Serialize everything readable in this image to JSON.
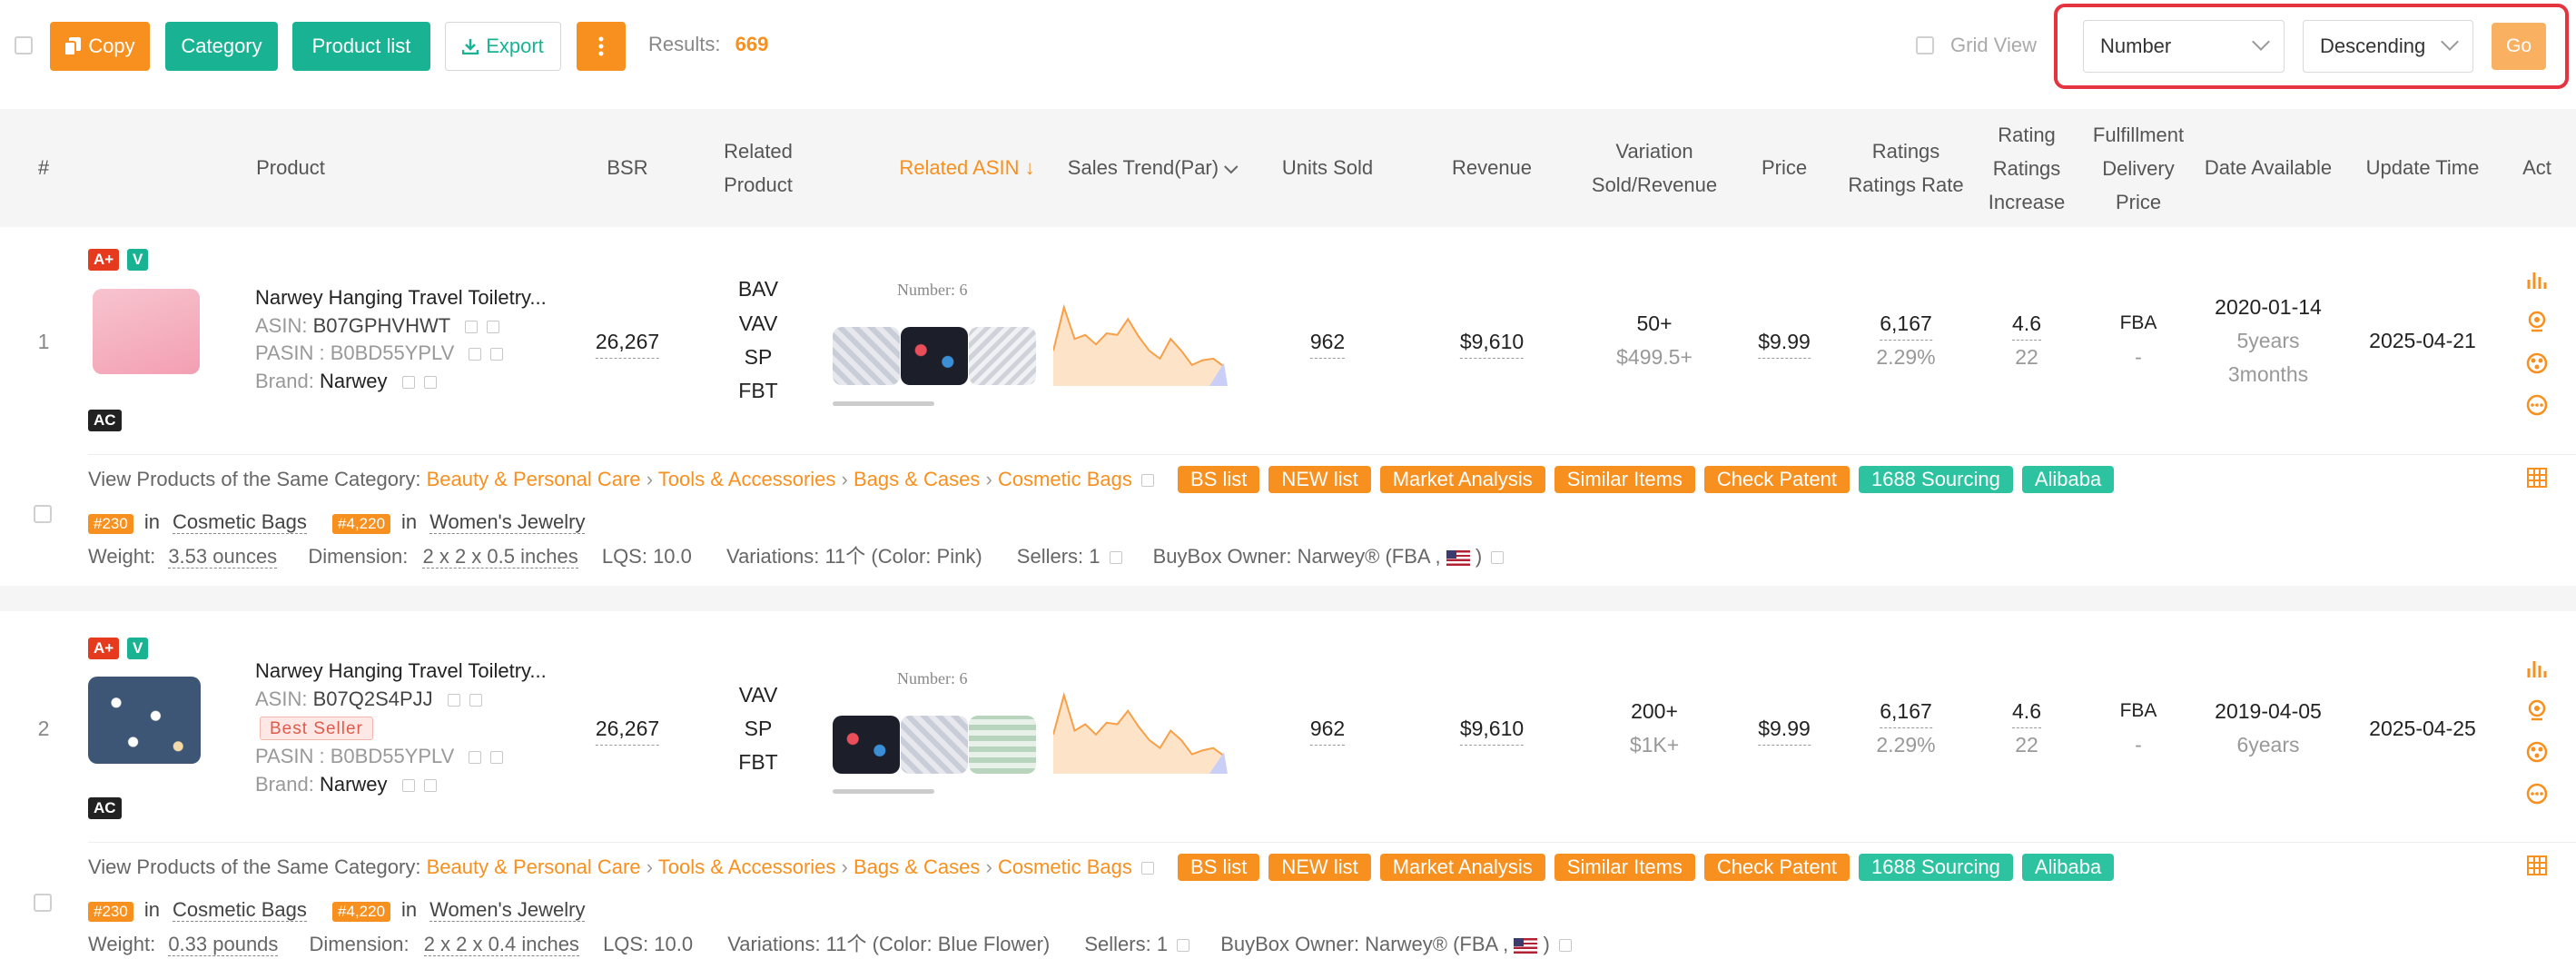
{
  "toolbar": {
    "copy_label": "Copy",
    "category_label": "Category",
    "product_list_label": "Product list",
    "export_label": "Export",
    "results_label": "Results:",
    "results_count": "669",
    "grid_view_label": "Grid View",
    "sort_field": "Number",
    "sort_order": "Descending",
    "go_label": "Go",
    "accent": "#f7901e",
    "teal": "#19b394",
    "highlight_border": "#e5333f"
  },
  "columns": [
    "#",
    "Product",
    "BSR",
    "Related",
    "Product",
    "Related ASIN",
    "Sales Trend(Par)",
    "Units Sold",
    "Revenue",
    "Variation",
    "Sold/Revenue",
    "Price",
    "Ratings",
    "Ratings Rate",
    "Rating",
    "Ratings",
    "Increase",
    "Fulfillment",
    "Delivery",
    "Price",
    "Date Available",
    "Update Time",
    "Act"
  ],
  "rows": [
    {
      "index": "1",
      "badges": [
        "A+",
        "V",
        "AC"
      ],
      "title": "Narwey Hanging Travel Toiletry...",
      "asin_label": "ASIN:",
      "asin": "B07GPHVHWT",
      "pasin_label": "PASIN : ",
      "pasin": "B0BD55YPLV",
      "brand_label": "Brand:",
      "brand": "Narwey",
      "best_seller": "",
      "bsr": "26,267",
      "related": [
        "BAV",
        "VAV",
        "SP",
        "FBT"
      ],
      "related_number": "Number: 6",
      "units_sold": "962",
      "revenue": "$9,610",
      "variation_sold": "50+",
      "variation_revenue": "$499.5+",
      "price": "$9.99",
      "ratings": "6,167",
      "ratings_rate": "2.29%",
      "rating": "4.6",
      "rating_increase": "22",
      "fulfillment": "FBA",
      "delivery": "-",
      "date_available": "2020-01-14",
      "age_line1": "5years",
      "age_line2": "3months",
      "update_time": "2025-04-21",
      "category_prefix": "View Products of the Same Category:",
      "category_path": [
        "Beauty & Personal Care",
        "Tools & Accessories",
        "Bags & Cases",
        "Cosmetic Bags"
      ],
      "tags": [
        "BS list",
        "NEW list",
        "Market Analysis",
        "Similar Items",
        "Check Patent",
        "1688 Sourcing",
        "Alibaba"
      ],
      "rank1": "#230",
      "rank1_in": "in",
      "rank1_cat": "Cosmetic Bags",
      "rank2": "#4,220",
      "rank2_in": "in",
      "rank2_cat": "Women's Jewelry",
      "weight_label": "Weight:",
      "weight": "3.53 ounces",
      "dimension_label": "Dimension:",
      "dimension": "2 x 2 x 0.5 inches",
      "lqs": "LQS: 10.0",
      "variations": "Variations: 11个 (Color: Pink)",
      "sellers": "Sellers: 1",
      "buybox": "BuyBox Owner: Narwey® (FBA ,",
      "buybox_end": ")",
      "trend": [
        40,
        95,
        55,
        60,
        48,
        62,
        60,
        80,
        58,
        40,
        30,
        55,
        40,
        22,
        28,
        30,
        20
      ]
    },
    {
      "index": "2",
      "badges": [
        "A+",
        "V",
        "AC"
      ],
      "title": "Narwey Hanging Travel Toiletry...",
      "asin_label": "ASIN:",
      "asin": "B07Q2S4PJJ",
      "pasin_label": "PASIN : ",
      "pasin": "B0BD55YPLV",
      "brand_label": "Brand:",
      "brand": "Narwey",
      "best_seller": "Best Seller",
      "bsr": "26,267",
      "related": [
        "VAV",
        "SP",
        "FBT"
      ],
      "related_number": "Number: 6",
      "units_sold": "962",
      "revenue": "$9,610",
      "variation_sold": "200+",
      "variation_revenue": "$1K+",
      "price": "$9.99",
      "ratings": "6,167",
      "ratings_rate": "2.29%",
      "rating": "4.6",
      "rating_increase": "22",
      "fulfillment": "FBA",
      "delivery": "-",
      "date_available": "2019-04-05",
      "age_line1": "6years",
      "age_line2": "",
      "update_time": "2025-04-25",
      "category_prefix": "View Products of the Same Category:",
      "category_path": [
        "Beauty & Personal Care",
        "Tools & Accessories",
        "Bags & Cases",
        "Cosmetic Bags"
      ],
      "tags": [
        "BS list",
        "NEW list",
        "Market Analysis",
        "Similar Items",
        "Check Patent",
        "1688 Sourcing",
        "Alibaba"
      ],
      "rank1": "#230",
      "rank1_in": "in",
      "rank1_cat": "Cosmetic Bags",
      "rank2": "#4,220",
      "rank2_in": "in",
      "rank2_cat": "Women's Jewelry",
      "weight_label": "Weight:",
      "weight": "0.33 pounds",
      "dimension_label": "Dimension:",
      "dimension": "2 x 2 x 0.4 inches",
      "lqs": "LQS: 10.0",
      "variations": "Variations: 11个 (Color: Blue Flower)",
      "sellers": "Sellers: 1",
      "buybox": "BuyBox Owner: Narwey® (FBA ,",
      "buybox_end": ")",
      "trend": [
        45,
        95,
        50,
        58,
        45,
        60,
        58,
        75,
        55,
        38,
        28,
        50,
        38,
        20,
        25,
        28,
        18
      ]
    }
  ]
}
